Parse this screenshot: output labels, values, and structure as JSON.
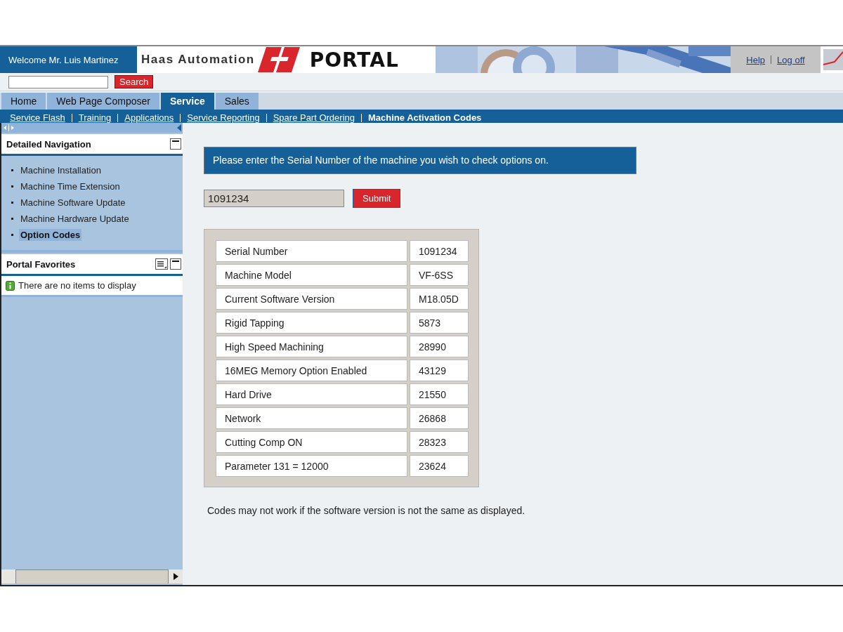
{
  "header": {
    "welcome": "Welcome Mr. Luis Martinez",
    "logo": {
      "brand": "Haas Automation",
      "title": "PORTAL"
    },
    "links": [
      {
        "label": "Help"
      },
      {
        "label": "Log off"
      }
    ]
  },
  "search": {
    "button": "Search"
  },
  "tabs": [
    {
      "label": "Home",
      "selected": false
    },
    {
      "label": "Web Page Composer",
      "selected": false
    },
    {
      "label": "Service",
      "selected": true
    },
    {
      "label": "Sales",
      "selected": false
    }
  ],
  "subnav": [
    {
      "label": "Service Flash",
      "selected": false
    },
    {
      "label": "Training",
      "selected": false
    },
    {
      "label": "Applications",
      "selected": false
    },
    {
      "label": "Service Reporting",
      "selected": false
    },
    {
      "label": "Spare Part Ordering",
      "selected": false
    },
    {
      "label": "Machine Activation Codes",
      "selected": true
    }
  ],
  "sidebar": {
    "navigation": {
      "title": "Detailed Navigation",
      "items": [
        {
          "label": "Machine Installation",
          "selected": false
        },
        {
          "label": "Machine Time Extension",
          "selected": false
        },
        {
          "label": "Machine Software Update",
          "selected": false
        },
        {
          "label": "Machine Hardware Update",
          "selected": false
        },
        {
          "label": "Option Codes",
          "selected": true
        }
      ]
    },
    "favorites": {
      "title": "Portal Favorites",
      "message": "There are no items to display"
    }
  },
  "main": {
    "prompt": "Please enter the Serial Number of the machine you wish to check options on.",
    "serial_field": {
      "value": "1091234"
    },
    "submit": "Submit",
    "table": {
      "rows": [
        {
          "label": "Serial Number",
          "value": "1091234"
        },
        {
          "label": "Machine Model",
          "value": "VF-6SS"
        },
        {
          "label": "Current Software Version",
          "value": "M18.05D"
        },
        {
          "label": "Rigid Tapping",
          "value": "5873"
        },
        {
          "label": "High Speed Machining",
          "value": "28990"
        },
        {
          "label": "16MEG Memory Option Enabled",
          "value": "43129"
        },
        {
          "label": "Hard Drive",
          "value": "21550"
        },
        {
          "label": "Network",
          "value": "26868"
        },
        {
          "label": "Cutting Comp ON",
          "value": "28323"
        },
        {
          "label": "Parameter 131 = 12000",
          "value": "23624"
        }
      ]
    },
    "note": "Codes may not work if the software version is not the same as displayed."
  }
}
